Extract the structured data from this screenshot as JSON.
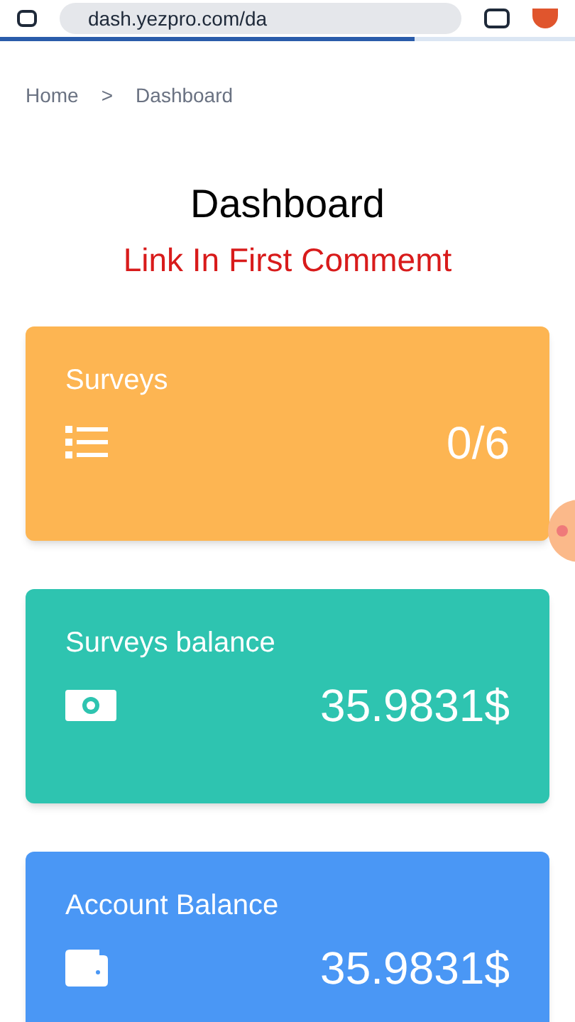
{
  "browser": {
    "url": "dash.yezpro.com/da",
    "progress": {
      "level": 0.72
    }
  },
  "breadcrumb": [
    "Home",
    "Dashboard"
  ],
  "breadcrumb_separator": ">",
  "title": "Dashboard",
  "promo": "Link In First Commemt",
  "cards": [
    {
      "label": "Surveys",
      "value": "0/6",
      "kind": "list",
      "color": "#fdb552"
    },
    {
      "label": "Surveys balance",
      "value": "35.9831$",
      "kind": "cash",
      "color": "#2ec4b0"
    },
    {
      "label": "Account Balance",
      "value": "35.9831$",
      "kind": "wallet",
      "color": "#4a97f5"
    }
  ]
}
